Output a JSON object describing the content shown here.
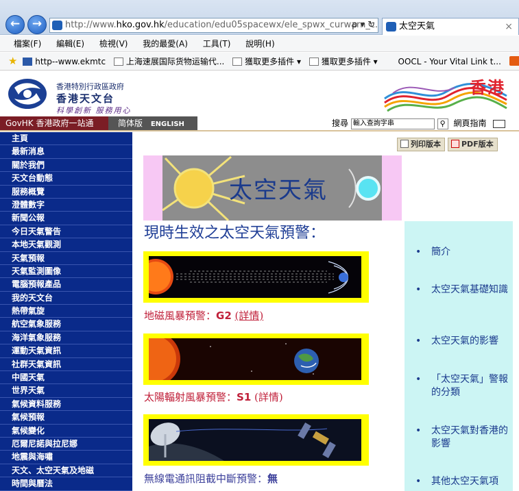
{
  "browser": {
    "url_prefix": "http://www.",
    "url_domain": "hko.gov.hk",
    "url_rest": "/education/edu05spacewx/ele_spwx_curwarn_c.ht",
    "url_controls": "ρ ▾ ↻",
    "tab_title": "太空天氣",
    "tab_close": "×",
    "menu": [
      "檔案(F)",
      "編輯(E)",
      "檢視(V)",
      "我的最愛(A)",
      "工具(T)",
      "說明(H)"
    ],
    "favorites": [
      "http--www.ekmtc",
      "上海速展国际货物运输代...",
      "獲取更多插件 ▾",
      "獲取更多插件 ▾",
      "OOCL - Your Vital Link t..."
    ]
  },
  "header": {
    "gov_small": "香港特別行政區政府",
    "org_name": "香港天文台",
    "motto": "科學創新 服務用心",
    "brand": "香港"
  },
  "govbar": {
    "govhk": "GovHK 香港政府一站通",
    "simplified": "简体版",
    "english": "ENGLISH",
    "search_label": "搜尋",
    "search_placeholder": "輸入查詢字串",
    "site_index": "網頁指南"
  },
  "leftnav": [
    "主頁",
    "最新消息",
    "關於我們",
    "天文台動態",
    "服務概覽",
    "澄體數字",
    "新聞公報",
    "今日天氣警告",
    "本地天氣觀測",
    "天氣預報",
    "天氣監測圖像",
    "電腦預報產品",
    "我的天文台",
    "熱帶氣旋",
    "航空氣象服務",
    "海洋氣象服務",
    "運動天氣資訊",
    "社群天氣資訊",
    "中國天氣",
    "世界天氣",
    "氣候資料服務",
    "氣候預報",
    "氣候變化",
    "厄爾尼諾與拉尼娜",
    "地震與海嘯",
    "天文、太空天氣及地磁",
    "時間與曆法"
  ],
  "tools": {
    "print": "列印版本",
    "pdf": "PDF版本"
  },
  "banner": {
    "title": "太空天氣"
  },
  "main": {
    "title": "現時生效之太空天氣預警：",
    "warnings": [
      {
        "label": "地磁風暴預警：",
        "level": "G2",
        "details": "(詳情)"
      },
      {
        "label": "太陽輻射風暴預警：",
        "level": "S1",
        "details": "(詳情)"
      },
      {
        "label": "無線電通訊阻截中斷預警：",
        "level": "無",
        "details": ""
      }
    ]
  },
  "sidebar": {
    "bullet": "•",
    "links": [
      "簡介",
      "太空天氣基礎知識",
      "太空天氣的影響",
      "「太空天氣」警報的分類",
      "太空天氣對香港的影響",
      "其他太空天氣項"
    ]
  }
}
